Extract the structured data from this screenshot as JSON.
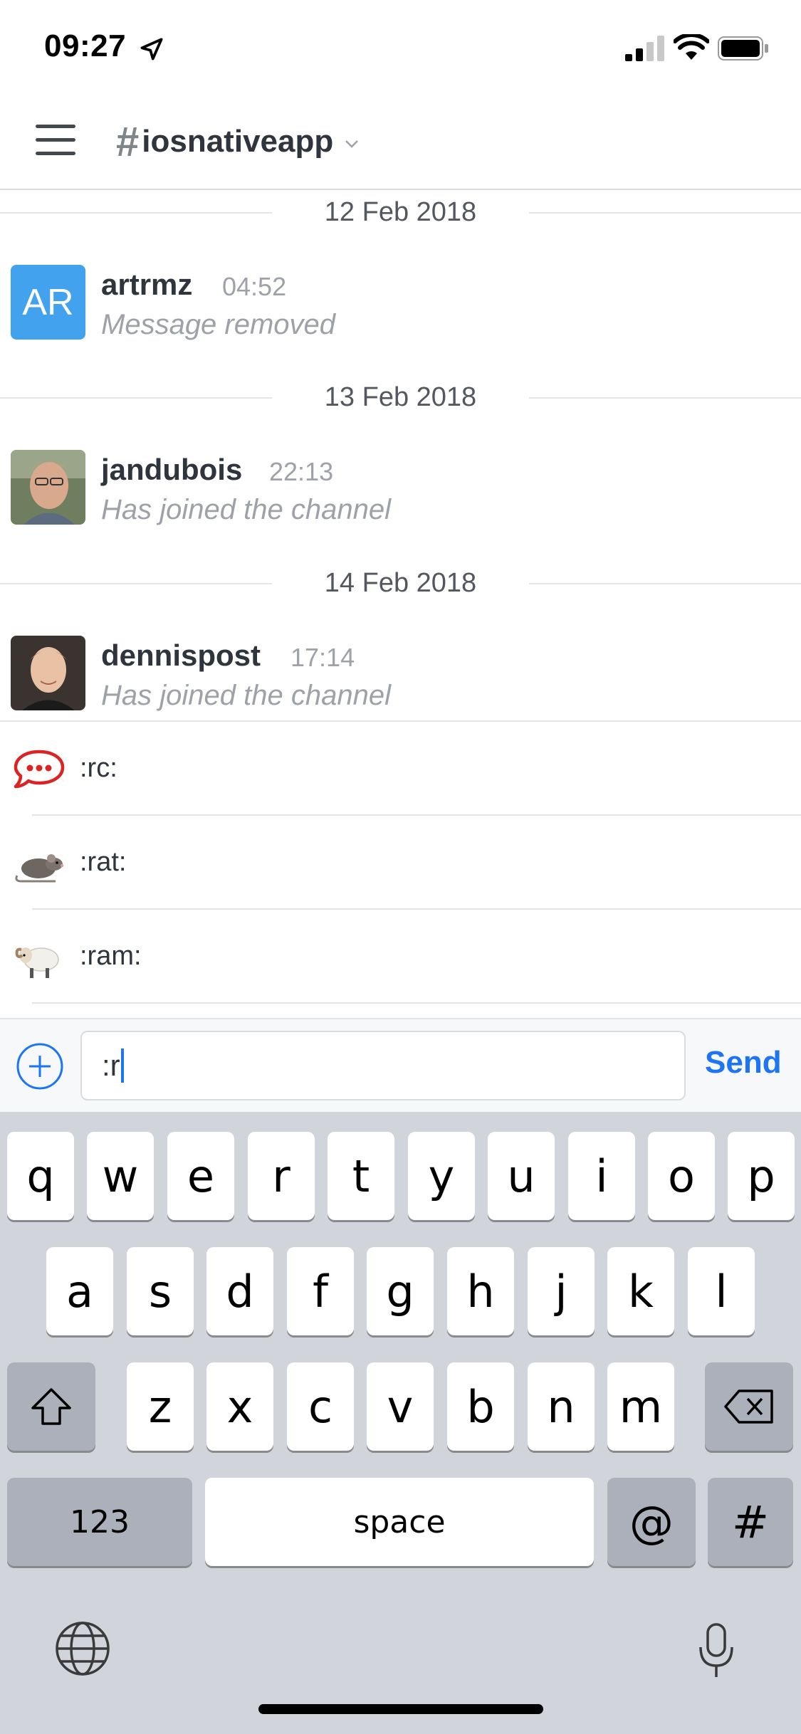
{
  "status_bar": {
    "time": "09:27"
  },
  "header": {
    "channel_name": "iosnativeapp"
  },
  "messages": [
    {
      "date": "12 Feb 2018",
      "avatar_text": "AR",
      "username": "artrmz",
      "time": "04:52",
      "body": "Message removed"
    },
    {
      "date": "13 Feb 2018",
      "username": "jandubois",
      "time": "22:13",
      "body": "Has joined the channel"
    },
    {
      "date": "14 Feb 2018",
      "username": "dennispost",
      "time": "17:14",
      "body": "Has joined the channel"
    }
  ],
  "emoji_suggestions": [
    {
      "code": ":rc:",
      "icon": "rocketchat-icon"
    },
    {
      "code": ":rat:",
      "icon": "rat-emoji"
    },
    {
      "code": ":ram:",
      "icon": "ram-emoji"
    }
  ],
  "composer": {
    "value": ":r",
    "send_label": "Send"
  },
  "keyboard": {
    "row1": [
      "q",
      "w",
      "e",
      "r",
      "t",
      "y",
      "u",
      "i",
      "o",
      "p"
    ],
    "row2": [
      "a",
      "s",
      "d",
      "f",
      "g",
      "h",
      "j",
      "k",
      "l"
    ],
    "row3": [
      "z",
      "x",
      "c",
      "v",
      "b",
      "n",
      "m"
    ],
    "numbers_label": "123",
    "space_label": "space",
    "at_label": "@",
    "hash_label": "#"
  },
  "colors": {
    "accent": "#1d74f5",
    "avatar_bg": "#42a2ed",
    "keyboard_bg": "#d1d4da"
  }
}
